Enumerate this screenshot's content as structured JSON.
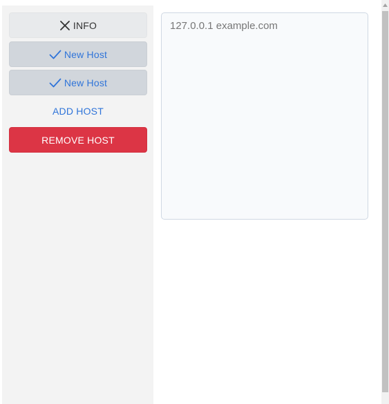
{
  "sidebar": {
    "info_button": {
      "label": "INFO",
      "icon": "close-icon"
    },
    "hosts": [
      {
        "label": "New Host",
        "icon": "check-icon",
        "selected": true
      },
      {
        "label": "New Host",
        "icon": "check-icon",
        "selected": true
      }
    ],
    "add_host_label": "ADD HOST",
    "remove_host_label": "REMOVE HOST"
  },
  "editor": {
    "placeholder": "127.0.0.1 example.com",
    "value": ""
  },
  "colors": {
    "accent": "#2f74d9",
    "danger": "#dc3545",
    "sidebar_bg": "#f3f3f3",
    "host_button_bg": "#d1d6dc",
    "info_button_bg": "#e8eaec"
  }
}
